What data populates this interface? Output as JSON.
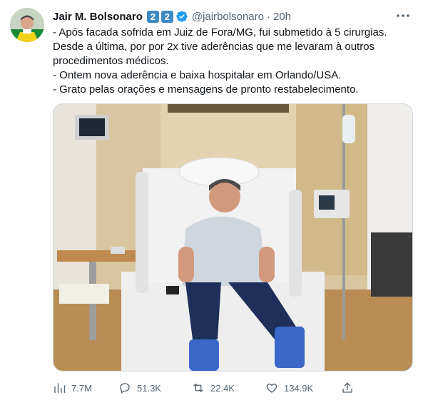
{
  "tweet": {
    "author_name": "Jair M. Bolsonaro",
    "emoji_badges": [
      "2",
      "2"
    ],
    "handle": "@jairbolsonaro",
    "separator": "·",
    "time": "20h",
    "text_lines": [
      "- Após facada sofrida em Juiz de Fora/MG, fui submetido à 5 cirurgias.",
      "Desde a última, por por 2x tive aderências que me levaram à outros",
      "procedimentos médicos.",
      "- Ontem nova aderência e baixa hospitalar em Orlando/USA.",
      "- Grato pelas orações e mensagens de pronto restabelecimento."
    ]
  },
  "actions": {
    "views": "7.7M",
    "replies": "51.3K",
    "retweets": "22.4K",
    "likes": "134.9K"
  },
  "icons": {
    "verified": "verified-badge-icon",
    "more": "more-options-icon",
    "views": "bar-chart-icon",
    "reply": "speech-bubble-icon",
    "retweet": "retweet-icon",
    "like": "heart-icon",
    "share": "share-upload-icon"
  },
  "colors": {
    "text": "#0f1419",
    "secondary": "#536471",
    "verified": "#1d9bf0",
    "emoji_box": "#3b88c3",
    "border": "#cfd9de"
  }
}
